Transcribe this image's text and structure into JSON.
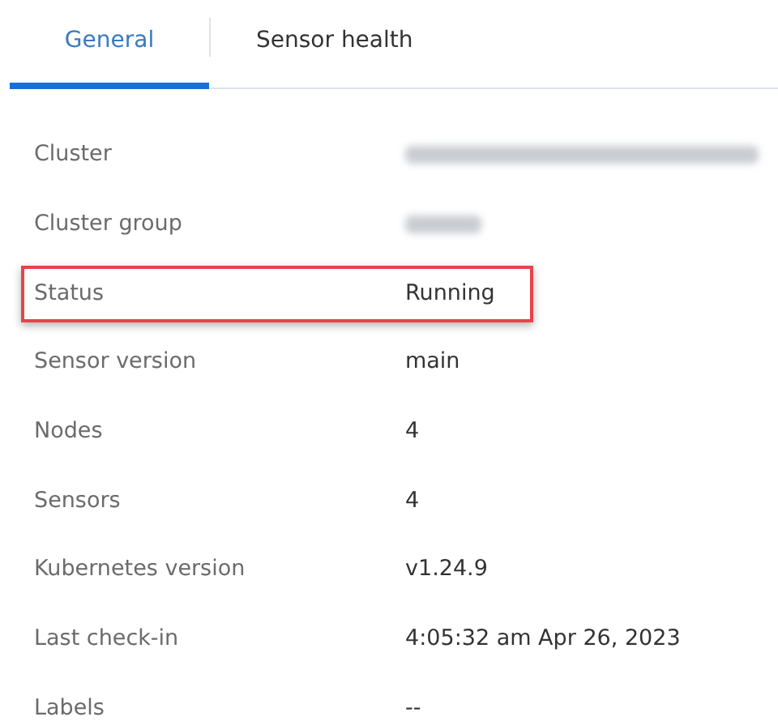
{
  "tabs": [
    {
      "label": "General",
      "selected": true
    },
    {
      "label": "Sensor health",
      "selected": false
    }
  ],
  "rows": [
    {
      "label": "Cluster",
      "kind": "redacted",
      "highlighted": false
    },
    {
      "label": "Cluster group",
      "kind": "redacted",
      "highlighted": false
    },
    {
      "label": "Status",
      "kind": "text",
      "value": "Running",
      "highlighted": true
    },
    {
      "label": "Sensor version",
      "kind": "text",
      "value": "main",
      "highlighted": false
    },
    {
      "label": "Nodes",
      "kind": "text",
      "value": "4",
      "highlighted": false
    },
    {
      "label": "Sensors",
      "kind": "text",
      "value": "4",
      "highlighted": false
    },
    {
      "label": "Kubernetes version",
      "kind": "text",
      "value": "v1.24.9",
      "highlighted": false
    },
    {
      "label": "Last check-in",
      "kind": "text",
      "value": "4:05:32 am Apr 26, 2023",
      "highlighted": false
    },
    {
      "label": "Labels",
      "kind": "text",
      "value": "--",
      "highlighted": false
    }
  ]
}
